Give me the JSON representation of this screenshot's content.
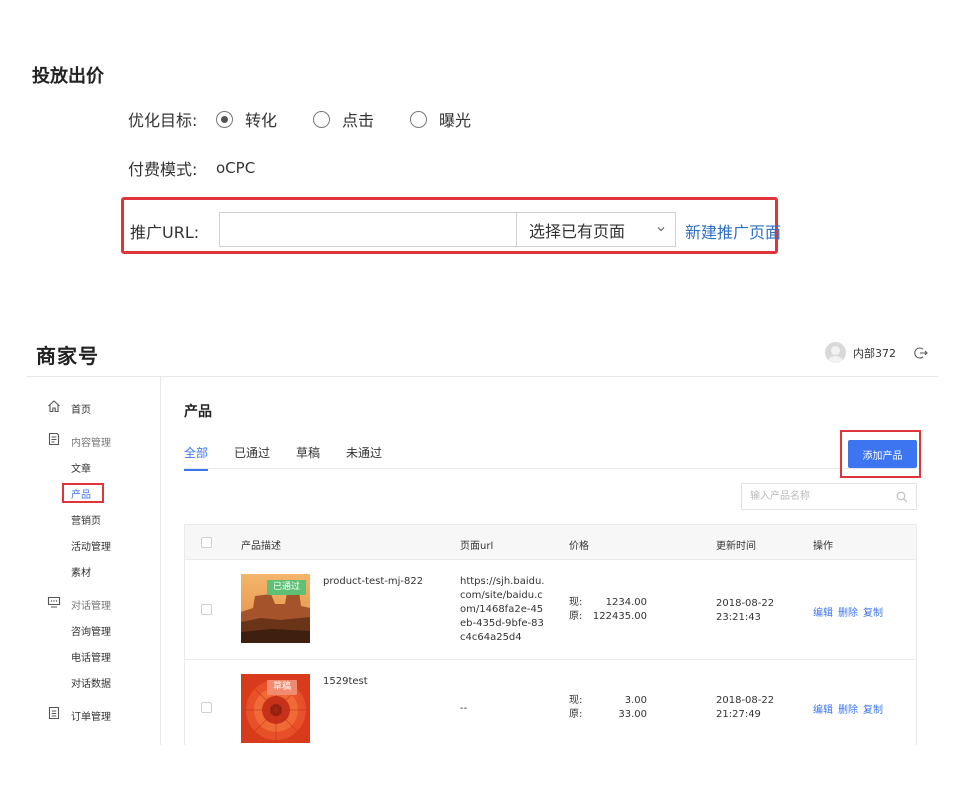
{
  "bid": {
    "title": "投放出价",
    "goal_label": "优化目标:",
    "goal_options": [
      {
        "label": "转化",
        "checked": true
      },
      {
        "label": "点击",
        "checked": false
      },
      {
        "label": "曝光",
        "checked": false
      }
    ],
    "pay_label": "付费模式:",
    "pay_value": "oCPC",
    "url_label": "推广URL:",
    "url_value": "",
    "select_value": "选择已有页面",
    "new_page_link": "新建推广页面"
  },
  "app": {
    "brand": "商家号",
    "user_name": "内部372"
  },
  "sidebar": {
    "items": [
      {
        "label": "首页",
        "icon": "home-icon"
      },
      {
        "label": "内容管理",
        "icon": "document-icon"
      },
      {
        "label": "文章"
      },
      {
        "label": "产品"
      },
      {
        "label": "营销页"
      },
      {
        "label": "活动管理"
      },
      {
        "label": "素材"
      },
      {
        "label": "对话管理",
        "icon": "chat-icon"
      },
      {
        "label": "咨询管理"
      },
      {
        "label": "电话管理"
      },
      {
        "label": "对话数据"
      },
      {
        "label": "订单管理",
        "icon": "order-icon"
      }
    ]
  },
  "main": {
    "title": "产品",
    "tabs": [
      "全部",
      "已通过",
      "草稿",
      "未通过"
    ],
    "add_button": "添加产品",
    "search_placeholder": "输入产品名称",
    "columns": [
      "产品描述",
      "页面url",
      "价格",
      "更新时间",
      "操作"
    ],
    "rows": [
      {
        "status": "已通过",
        "name": "product-test-mj-822",
        "url": "https://sjh.baidu.com/site/baidu.com/1468fa2e-45eb-435d-9bfe-83c4c64a25d4",
        "current_label": "现:",
        "current_price": "1234.00",
        "original_label": "原:",
        "original_price": "122435.00",
        "date": "2018-08-22",
        "time": "23:21:43",
        "ops": [
          "编辑",
          "删除",
          "复制"
        ]
      },
      {
        "status": "草稿",
        "name": "1529test",
        "url": "--",
        "current_label": "现:",
        "current_price": "3.00",
        "original_label": "原:",
        "original_price": "33.00",
        "date": "2018-08-22",
        "time": "21:27:49",
        "ops": [
          "编辑",
          "删除",
          "复制"
        ]
      }
    ]
  },
  "colors": {
    "accent": "#3d74f0",
    "highlight": "#e0343c",
    "link": "#2f6fc4",
    "badge_pass": "#5fbf74",
    "badge_draft": "#f08a70"
  }
}
